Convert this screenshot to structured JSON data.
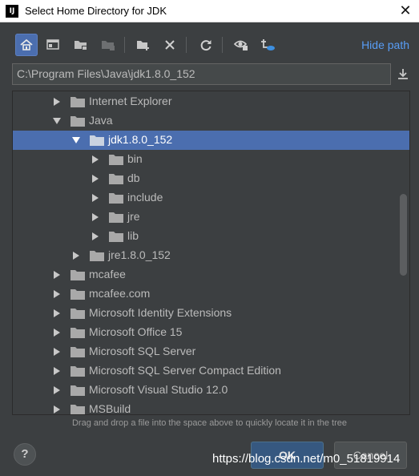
{
  "window": {
    "title": "Select Home Directory for JDK",
    "app_icon_text": "IJ",
    "close_glyph": "✕"
  },
  "toolbar": {
    "buttons": [
      {
        "icon": "home-icon",
        "active": true
      },
      {
        "icon": "desktop-icon",
        "active": false
      },
      {
        "icon": "project-folder-icon",
        "active": false
      },
      {
        "icon": "module-folder-icon",
        "active": false
      },
      {
        "icon": "new-folder-icon",
        "active": false
      },
      {
        "icon": "delete-icon",
        "active": false
      },
      {
        "icon": "refresh-icon",
        "active": false
      },
      {
        "icon": "show-hidden-icon",
        "active": false
      },
      {
        "icon": "collapse-tree-icon",
        "active": false
      }
    ],
    "hide_path_label": "Hide path"
  },
  "path_field": {
    "value": "C:\\Program Files\\Java\\jdk1.8.0_152"
  },
  "tree": {
    "rows": [
      {
        "label": "Internet Explorer",
        "depth": 1,
        "expanded": false,
        "selected": false
      },
      {
        "label": "Java",
        "depth": 1,
        "expanded": true,
        "selected": false
      },
      {
        "label": "jdk1.8.0_152",
        "depth": 2,
        "expanded": true,
        "selected": true
      },
      {
        "label": "bin",
        "depth": 3,
        "expanded": false,
        "selected": false
      },
      {
        "label": "db",
        "depth": 3,
        "expanded": false,
        "selected": false
      },
      {
        "label": "include",
        "depth": 3,
        "expanded": false,
        "selected": false
      },
      {
        "label": "jre",
        "depth": 3,
        "expanded": false,
        "selected": false
      },
      {
        "label": "lib",
        "depth": 3,
        "expanded": false,
        "selected": false
      },
      {
        "label": "jre1.8.0_152",
        "depth": 2,
        "expanded": false,
        "selected": false
      },
      {
        "label": "mcafee",
        "depth": 1,
        "expanded": false,
        "selected": false
      },
      {
        "label": "mcafee.com",
        "depth": 1,
        "expanded": false,
        "selected": false
      },
      {
        "label": "Microsoft Identity Extensions",
        "depth": 1,
        "expanded": false,
        "selected": false
      },
      {
        "label": "Microsoft Office 15",
        "depth": 1,
        "expanded": false,
        "selected": false
      },
      {
        "label": "Microsoft SQL Server",
        "depth": 1,
        "expanded": false,
        "selected": false
      },
      {
        "label": "Microsoft SQL Server Compact Edition",
        "depth": 1,
        "expanded": false,
        "selected": false
      },
      {
        "label": "Microsoft Visual Studio 12.0",
        "depth": 1,
        "expanded": false,
        "selected": false
      },
      {
        "label": "MSBuild",
        "depth": 1,
        "expanded": false,
        "selected": false
      }
    ]
  },
  "hint": "Drag and drop a file into the space above to quickly locate it in the tree",
  "footer": {
    "help_label": "?",
    "ok_label": "OK",
    "cancel_label": "Cancel"
  },
  "watermark": "https://blog.csdn.net/m0_51819914",
  "colors": {
    "background": "#3c3f41",
    "selection": "#4b6eaf",
    "link": "#589df6",
    "text": "#bbbbbb"
  }
}
